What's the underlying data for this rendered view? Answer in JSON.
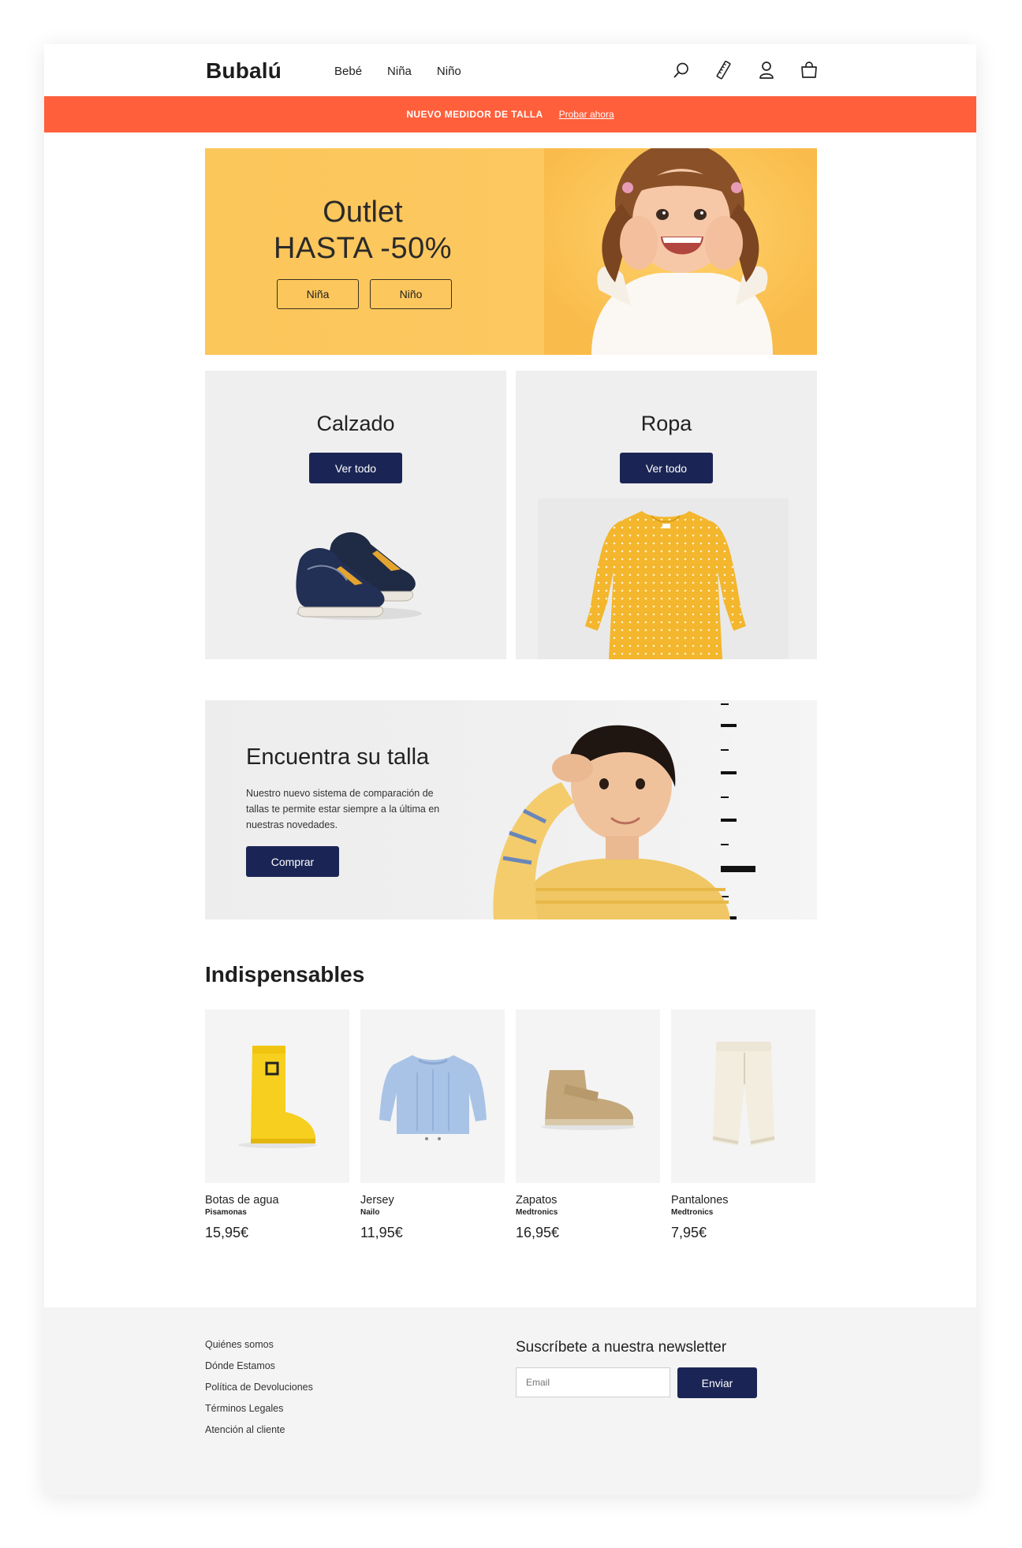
{
  "brand": {
    "logo": "Bubalú"
  },
  "nav": {
    "items": [
      "Bebé",
      "Niña",
      "Niño"
    ]
  },
  "header_icons": [
    "search-icon",
    "ruler-icon",
    "user-icon",
    "bag-icon"
  ],
  "promo": {
    "text": "NUEVO MEDIDOR DE TALLA",
    "link": "Probar ahora"
  },
  "hero": {
    "title": "Outlet",
    "subtitle": "HASTA -50%",
    "buttons": [
      "Niña",
      "Niño"
    ]
  },
  "categories": [
    {
      "title": "Calzado",
      "button": "Ver todo"
    },
    {
      "title": "Ropa",
      "button": "Ver todo"
    }
  ],
  "size_finder": {
    "title": "Encuentra su talla",
    "text": "Nuestro nuevo sistema de comparación de tallas te permite estar siempre a la última en nuestras novedades.",
    "button": "Comprar"
  },
  "essentials": {
    "title": "Indispensables",
    "products": [
      {
        "name": "Botas de agua",
        "brand": "Pisamonas",
        "price": "15,95€"
      },
      {
        "name": "Jersey",
        "brand": "Nailo",
        "price": "11,95€"
      },
      {
        "name": "Zapatos",
        "brand": "Medtronics",
        "price": "16,95€"
      },
      {
        "name": "Pantalones",
        "brand": "Medtronics",
        "price": "7,95€"
      }
    ]
  },
  "footer": {
    "links": [
      "Quiénes somos",
      "Dónde Estamos",
      "Política de Devoluciones",
      "Términos Legales",
      "Atención al cliente"
    ],
    "newsletter_title": "Suscríbete a nuestra newsletter",
    "email_placeholder": "Email",
    "send_button": "Enviar"
  },
  "colors": {
    "accent": "#ff5f3b",
    "primary": "#1b2555",
    "hero_bg": "#fdc860"
  }
}
